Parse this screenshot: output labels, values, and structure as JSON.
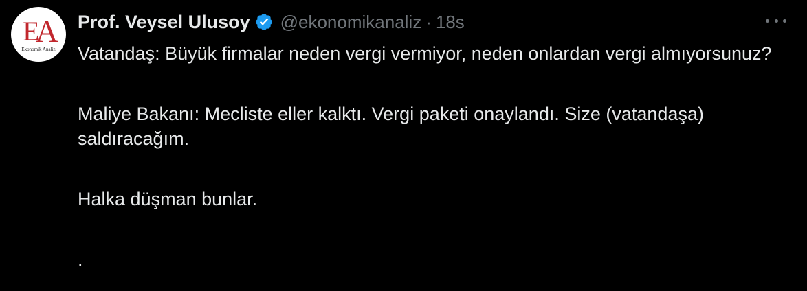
{
  "author": {
    "display_name": "Prof. Veysel Ulusoy",
    "handle": "@ekonomikanaliz",
    "separator": "·",
    "time": "18s",
    "avatar_logo": {
      "mark_e": "E",
      "mark_a": "A",
      "caption": "Ekonomik Analiz"
    },
    "verified": true
  },
  "colors": {
    "background": "#000000",
    "text": "#e7e9ea",
    "secondary": "#71767b",
    "verified_badge": "#1d9bf0",
    "logo_red": "#c1272d"
  },
  "tweet": {
    "paragraphs": [
      "Vatandaş: Büyük firmalar neden vergi vermiyor, neden onlardan vergi almıyorsunuz?",
      "Maliye Bakanı: Mecliste eller kalktı. Vergi paketi onaylandı. Size (vatandaşa) saldıracağım.",
      "Halka düşman bunlar.",
      "."
    ]
  },
  "icons": {
    "verified": "verified-badge-icon",
    "more": "more-options-icon"
  }
}
